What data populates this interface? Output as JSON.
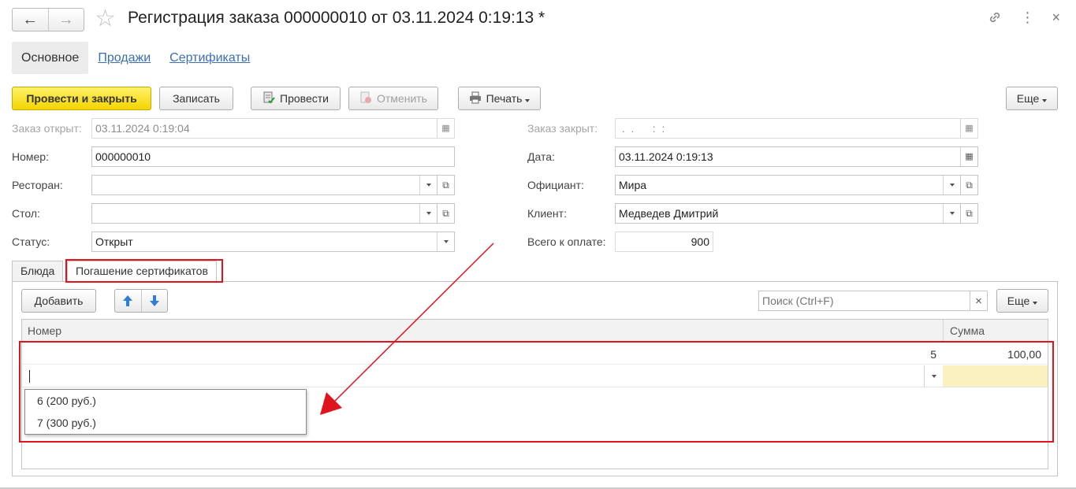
{
  "window": {
    "title": "Регистрация заказа 000000010 от 03.11.2024 0:19:13 *",
    "back_icon": "←",
    "forward_icon": "→",
    "star_icon": "☆",
    "link_icon": "🔗",
    "more_icon": "⋮",
    "close_icon": "×"
  },
  "section_tabs": [
    {
      "label": "Основное",
      "active": true
    },
    {
      "label": "Продажи",
      "active": false
    },
    {
      "label": "Сертификаты",
      "active": false
    }
  ],
  "toolbar": {
    "post_close": "Провести и закрыть",
    "save": "Записать",
    "post": "Провести",
    "cancel": "Отменить",
    "print": "Печать",
    "more": "Еще"
  },
  "form": {
    "opened_label": "Заказ открыт:",
    "opened_value": "03.11.2024  0:19:04",
    "number_label": "Номер:",
    "number_value": "000000010",
    "restaurant_label": "Ресторан:",
    "restaurant_value": "",
    "table_label": "Стол:",
    "table_value": "",
    "status_label": "Статус:",
    "status_value": "Открыт",
    "closed_label": "Заказ закрыт:",
    "closed_value": " .  .      :  :",
    "date_label": "Дата:",
    "date_value": "03.11.2024  0:19:13",
    "waiter_label": "Официант:",
    "waiter_value": "Мира",
    "client_label": "Клиент:",
    "client_value": "Медведев Дмитрий",
    "total_label": "Всего к оплате:",
    "total_value": "900"
  },
  "lower_tabs": [
    {
      "label": "Блюда",
      "active": false
    },
    {
      "label": "Погашение сертификатов",
      "active": true
    }
  ],
  "table_toolbar": {
    "add": "Добавить",
    "search_placeholder": "Поиск (Ctrl+F)",
    "more": "Еще"
  },
  "table": {
    "columns": [
      "Номер",
      "Сумма"
    ],
    "rows": [
      {
        "number": "5",
        "sum": "100,00"
      }
    ]
  },
  "dropdown_options": [
    "6 (200 руб.)",
    "7 (300 руб.)"
  ],
  "colors": {
    "accent_red": "#e0141e",
    "primary_button": "#f4d400",
    "link_blue": "#3b6eb4",
    "arrow_blue": "#2f7fd8"
  }
}
